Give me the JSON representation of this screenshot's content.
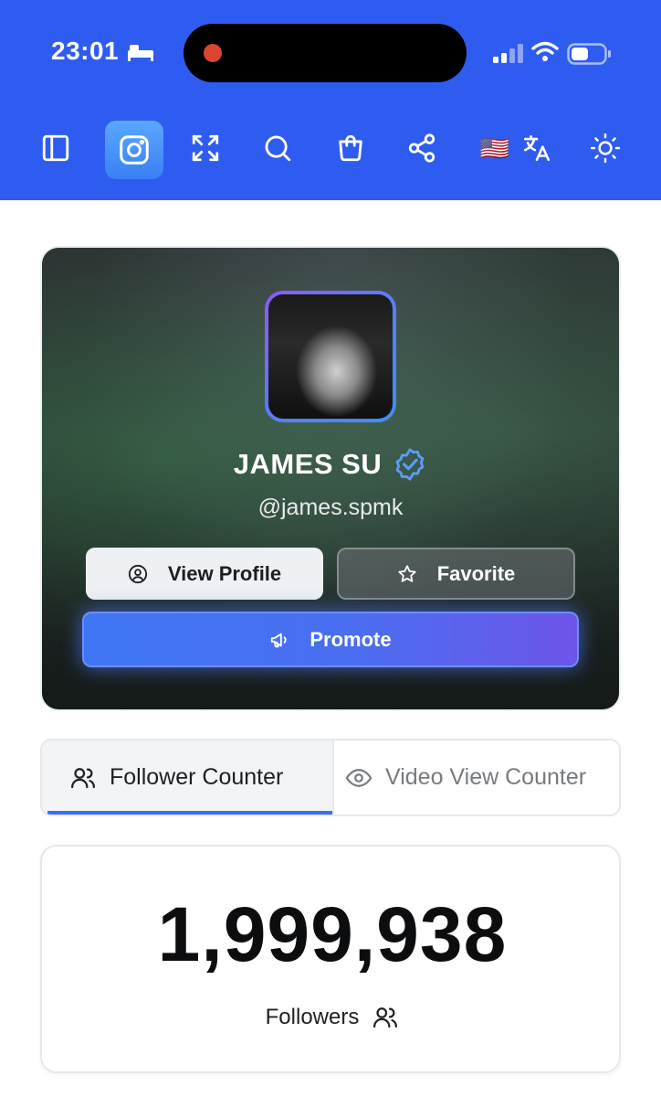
{
  "status_bar": {
    "time": "23:01"
  },
  "toolbar": {
    "items": [
      {
        "icon": "sidebar-toggle-icon"
      },
      {
        "icon": "instagram-icon",
        "active": true
      },
      {
        "icon": "fullscreen-icon"
      },
      {
        "icon": "search-icon"
      },
      {
        "icon": "shopping-bag-icon"
      },
      {
        "icon": "share-icon"
      },
      {
        "icon": "us-flag-icon",
        "text": "🇺🇸"
      },
      {
        "icon": "translate-icon"
      },
      {
        "icon": "sun-icon"
      }
    ]
  },
  "profile": {
    "name": "JAMES SU",
    "handle": "@james.spmk",
    "verified": true,
    "view_profile_label": "View Profile",
    "favorite_label": "Favorite",
    "promote_label": "Promote"
  },
  "tabs": {
    "followers_label": "Follower Counter",
    "views_label": "Video View Counter",
    "active": "followers"
  },
  "counter": {
    "value": "1,999,938",
    "label": "Followers"
  },
  "colors": {
    "header_blue": "#2f5cf0",
    "accent_blue": "#3b6ff3",
    "promote_gradient_end": "#6d54e8"
  }
}
